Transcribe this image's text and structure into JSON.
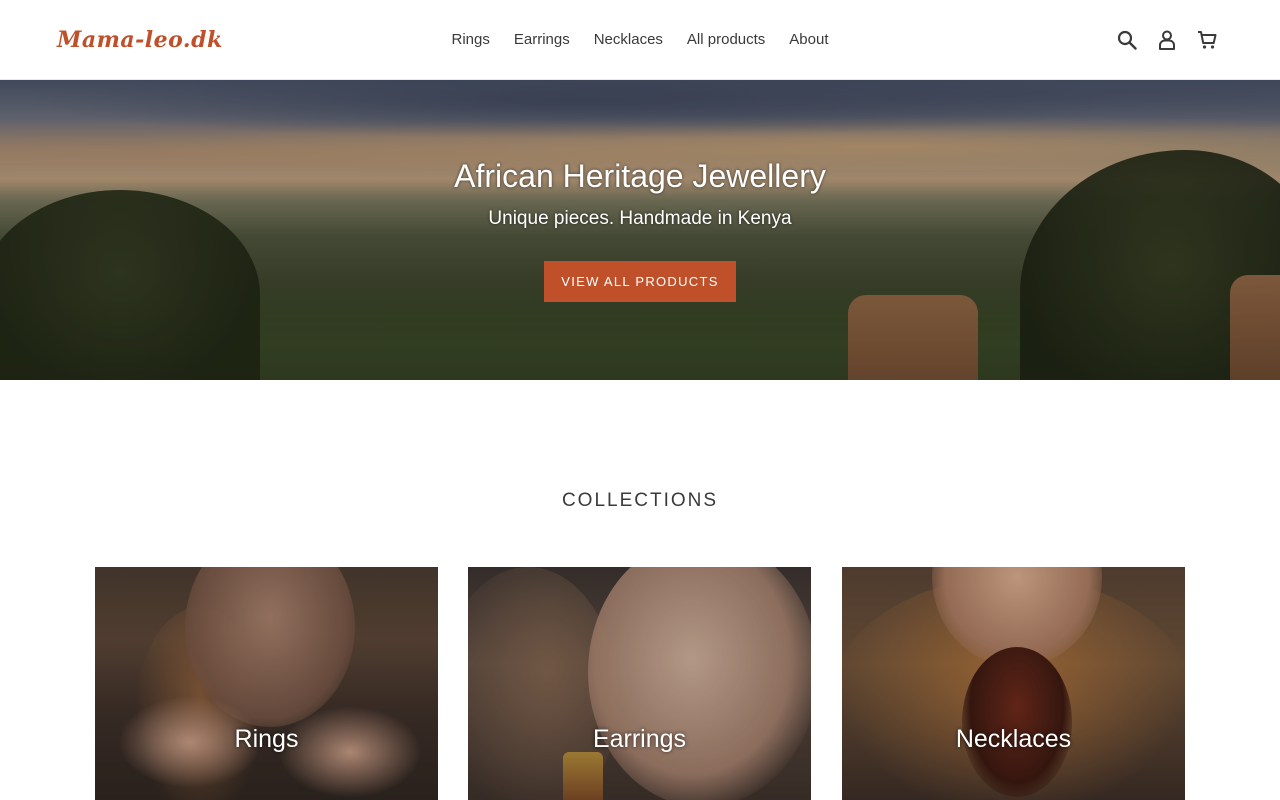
{
  "header": {
    "logo_text": "Mama-leo.dk",
    "nav": [
      {
        "label": "Rings"
      },
      {
        "label": "Earrings"
      },
      {
        "label": "Necklaces"
      },
      {
        "label": "All products"
      },
      {
        "label": "About"
      }
    ],
    "icons": [
      "search-icon",
      "account-icon",
      "cart-icon"
    ]
  },
  "hero": {
    "title": "African Heritage Jewellery",
    "subtitle": "Unique pieces. Handmade in Kenya",
    "button_label": "VIEW ALL PRODUCTS"
  },
  "collections": {
    "title": "COLLECTIONS",
    "items": [
      {
        "label": "Rings"
      },
      {
        "label": "Earrings"
      },
      {
        "label": "Necklaces"
      }
    ]
  },
  "colors": {
    "accent": "#c0502a",
    "text": "#3a3a3a",
    "background": "#ffffff"
  }
}
